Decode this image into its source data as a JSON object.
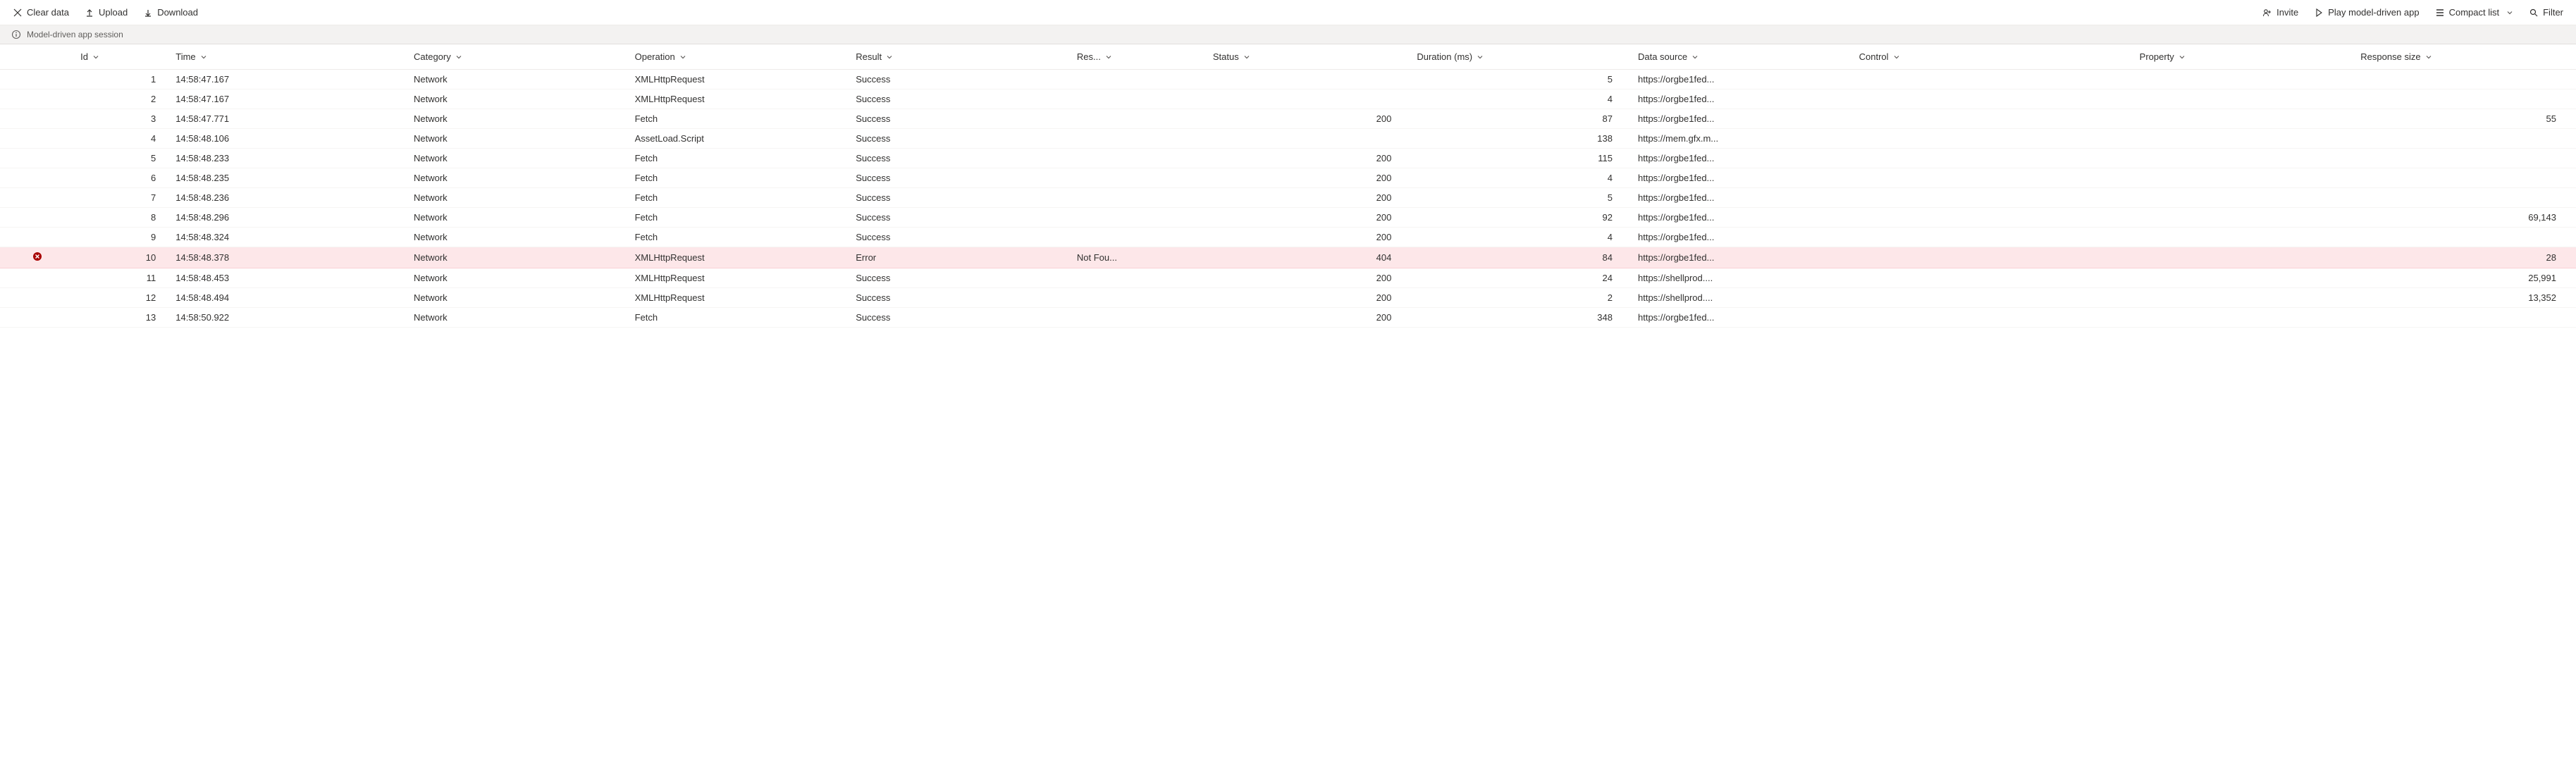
{
  "toolbar": {
    "clear_label": "Clear data",
    "upload_label": "Upload",
    "download_label": "Download",
    "invite_label": "Invite",
    "play_label": "Play model-driven app",
    "layout_label": "Compact list",
    "filter_label": "Filter"
  },
  "banner": {
    "text": "Model-driven app session"
  },
  "columns": {
    "id": "Id",
    "time": "Time",
    "category": "Category",
    "operation": "Operation",
    "result": "Result",
    "res_short": "Res...",
    "status": "Status",
    "duration": "Duration (ms)",
    "datasource": "Data source",
    "control": "Control",
    "property": "Property",
    "respsize": "Response size"
  },
  "rows": [
    {
      "id": "1",
      "time": "14:58:47.167",
      "category": "Network",
      "operation": "XMLHttpRequest",
      "result": "Success",
      "res_short": "",
      "status": "",
      "duration": "5",
      "datasource": "https://orgbe1fed...",
      "control": "",
      "property": "",
      "respsize": "",
      "error": false
    },
    {
      "id": "2",
      "time": "14:58:47.167",
      "category": "Network",
      "operation": "XMLHttpRequest",
      "result": "Success",
      "res_short": "",
      "status": "",
      "duration": "4",
      "datasource": "https://orgbe1fed...",
      "control": "",
      "property": "",
      "respsize": "",
      "error": false
    },
    {
      "id": "3",
      "time": "14:58:47.771",
      "category": "Network",
      "operation": "Fetch",
      "result": "Success",
      "res_short": "",
      "status": "200",
      "duration": "87",
      "datasource": "https://orgbe1fed...",
      "control": "",
      "property": "",
      "respsize": "55",
      "error": false
    },
    {
      "id": "4",
      "time": "14:58:48.106",
      "category": "Network",
      "operation": "AssetLoad.Script",
      "result": "Success",
      "res_short": "",
      "status": "",
      "duration": "138",
      "datasource": "https://mem.gfx.m...",
      "control": "",
      "property": "",
      "respsize": "",
      "error": false
    },
    {
      "id": "5",
      "time": "14:58:48.233",
      "category": "Network",
      "operation": "Fetch",
      "result": "Success",
      "res_short": "",
      "status": "200",
      "duration": "115",
      "datasource": "https://orgbe1fed...",
      "control": "",
      "property": "",
      "respsize": "",
      "error": false
    },
    {
      "id": "6",
      "time": "14:58:48.235",
      "category": "Network",
      "operation": "Fetch",
      "result": "Success",
      "res_short": "",
      "status": "200",
      "duration": "4",
      "datasource": "https://orgbe1fed...",
      "control": "",
      "property": "",
      "respsize": "",
      "error": false
    },
    {
      "id": "7",
      "time": "14:58:48.236",
      "category": "Network",
      "operation": "Fetch",
      "result": "Success",
      "res_short": "",
      "status": "200",
      "duration": "5",
      "datasource": "https://orgbe1fed...",
      "control": "",
      "property": "",
      "respsize": "",
      "error": false
    },
    {
      "id": "8",
      "time": "14:58:48.296",
      "category": "Network",
      "operation": "Fetch",
      "result": "Success",
      "res_short": "",
      "status": "200",
      "duration": "92",
      "datasource": "https://orgbe1fed...",
      "control": "",
      "property": "",
      "respsize": "69,143",
      "error": false
    },
    {
      "id": "9",
      "time": "14:58:48.324",
      "category": "Network",
      "operation": "Fetch",
      "result": "Success",
      "res_short": "",
      "status": "200",
      "duration": "4",
      "datasource": "https://orgbe1fed...",
      "control": "",
      "property": "",
      "respsize": "",
      "error": false
    },
    {
      "id": "10",
      "time": "14:58:48.378",
      "category": "Network",
      "operation": "XMLHttpRequest",
      "result": "Error",
      "res_short": "Not Fou...",
      "status": "404",
      "duration": "84",
      "datasource": "https://orgbe1fed...",
      "control": "",
      "property": "",
      "respsize": "28",
      "error": true
    },
    {
      "id": "11",
      "time": "14:58:48.453",
      "category": "Network",
      "operation": "XMLHttpRequest",
      "result": "Success",
      "res_short": "",
      "status": "200",
      "duration": "24",
      "datasource": "https://shellprod....",
      "control": "",
      "property": "",
      "respsize": "25,991",
      "error": false
    },
    {
      "id": "12",
      "time": "14:58:48.494",
      "category": "Network",
      "operation": "XMLHttpRequest",
      "result": "Success",
      "res_short": "",
      "status": "200",
      "duration": "2",
      "datasource": "https://shellprod....",
      "control": "",
      "property": "",
      "respsize": "13,352",
      "error": false
    },
    {
      "id": "13",
      "time": "14:58:50.922",
      "category": "Network",
      "operation": "Fetch",
      "result": "Success",
      "res_short": "",
      "status": "200",
      "duration": "348",
      "datasource": "https://orgbe1fed...",
      "control": "",
      "property": "",
      "respsize": "",
      "error": false
    }
  ]
}
